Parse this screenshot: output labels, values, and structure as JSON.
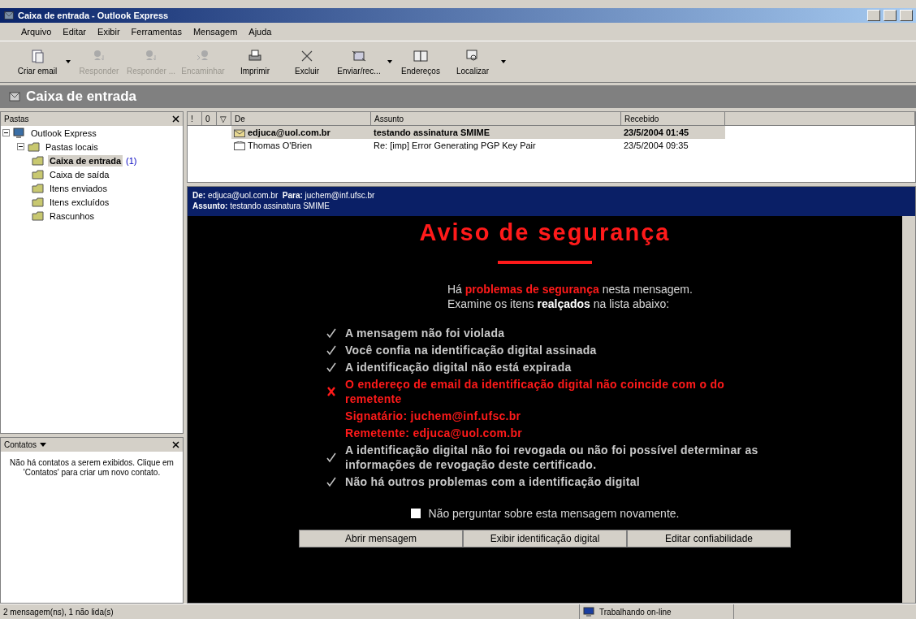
{
  "window": {
    "title": "Caixa de entrada - Outlook Express"
  },
  "menu": [
    "Arquivo",
    "Editar",
    "Exibir",
    "Ferramentas",
    "Mensagem",
    "Ajuda"
  ],
  "toolbar": [
    {
      "label": "Criar email",
      "disabled": false,
      "dropdown": true,
      "kind": "new"
    },
    {
      "label": "Responder",
      "disabled": true,
      "dropdown": false,
      "kind": "reply"
    },
    {
      "label": "Responder ...",
      "disabled": true,
      "dropdown": false,
      "kind": "reply"
    },
    {
      "label": "Encaminhar",
      "disabled": true,
      "dropdown": false,
      "kind": "forward"
    },
    {
      "label": "Imprimir",
      "disabled": false,
      "dropdown": false,
      "kind": "print"
    },
    {
      "label": "Excluir",
      "disabled": false,
      "dropdown": false,
      "kind": "delete"
    },
    {
      "label": "Enviar/rec...",
      "disabled": false,
      "dropdown": true,
      "kind": "sendrecv"
    },
    {
      "label": "Endereços",
      "disabled": false,
      "dropdown": false,
      "kind": "book"
    },
    {
      "label": "Localizar",
      "disabled": false,
      "dropdown": true,
      "kind": "find"
    }
  ],
  "folder_header": "Caixa de entrada",
  "folders_pane": {
    "title": "Pastas",
    "tree": [
      {
        "label": "Outlook Express",
        "selected": false,
        "expanded": true,
        "children": [
          {
            "label": "Pastas locais",
            "selected": false,
            "expanded": true,
            "children": [
              {
                "label": "Caixa de entrada",
                "count": "(1)",
                "selected": true
              },
              {
                "label": "Caixa de saída",
                "selected": false
              },
              {
                "label": "Itens enviados",
                "selected": false
              },
              {
                "label": "Itens excluídos",
                "selected": false
              },
              {
                "label": "Rascunhos",
                "selected": false
              }
            ]
          }
        ]
      }
    ]
  },
  "contacts_pane": {
    "title": "Contatos",
    "message": "Não há contatos a serem exibidos. Clique em 'Contatos' para criar um novo contato."
  },
  "message_list": {
    "columns": [
      "!",
      "0",
      "▽",
      "De",
      "Assunto",
      "Recebido"
    ],
    "rows": [
      {
        "from": "edjuca@uol.com.br",
        "subject": "testando assinatura SMIME",
        "received": "23/5/2004 01:45",
        "unread": true,
        "selected": true
      },
      {
        "from": "Thomas O'Brien",
        "subject": "Re: [imp] Error Generating PGP Key Pair",
        "received": "23/5/2004 09:35",
        "unread": false,
        "selected": false
      }
    ]
  },
  "preview_header": {
    "from_label": "De:",
    "from": "edjuca@uol.com.br",
    "to_label": "Para:",
    "to": "juchem@inf.ufsc.br",
    "subject_label": "Assunto:",
    "subject": "testando assinatura SMIME"
  },
  "security_notice": {
    "title": "Aviso de segurança",
    "intro": [
      {
        "kind": "warning",
        "text": "Há **problemas de segurança** nesta mensagem."
      },
      {
        "kind": "plain",
        "text": "Examine os itens **realçados** na lista abaixo:"
      }
    ],
    "items": [
      {
        "kind": "ok",
        "text": "A mensagem não foi violada"
      },
      {
        "kind": "ok",
        "text": "Você confia na identificação digital assinada"
      },
      {
        "kind": "ok",
        "text": "A identificação digital não está expirada"
      },
      {
        "kind": "fail",
        "text": "O endereço de email da identificação digital não coincide com o do remetente"
      },
      {
        "kind": "detail",
        "text": "Signatário: juchem@inf.ufsc.br"
      },
      {
        "kind": "detail",
        "text": "Remetente: edjuca@uol.com.br"
      },
      {
        "kind": "ok",
        "text": "A identificação digital não foi revogada ou não foi possível determinar as informações de revogação deste certificado."
      },
      {
        "kind": "ok",
        "text": "Não há outros problemas com a identificação digital"
      }
    ],
    "dont_ask": {
      "label": "Não perguntar sobre esta mensagem novamente.",
      "checked": false
    },
    "buttons": [
      "Abrir mensagem",
      "Exibir identificação digital",
      "Editar confiabilidade"
    ]
  },
  "status_bar": {
    "left": "2 mensagem(ns), 1 não lida(s)",
    "center": "Trabalhando on-line"
  }
}
